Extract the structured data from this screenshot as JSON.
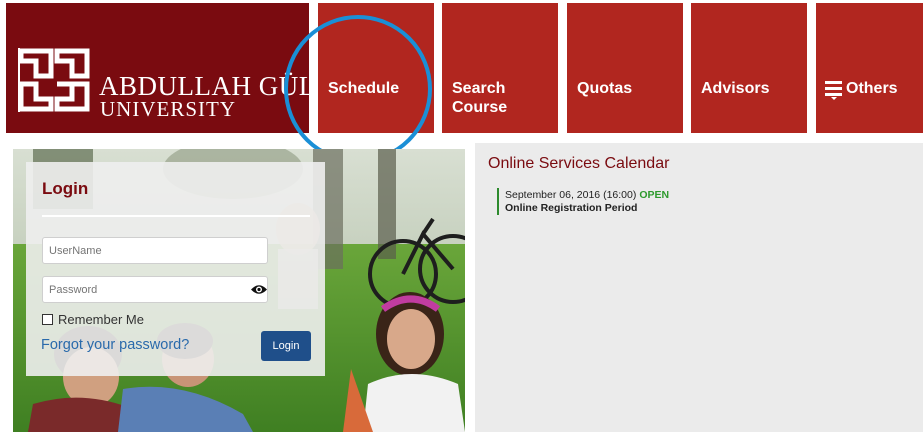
{
  "logo": {
    "line1": "ABDULLAH GÜL",
    "line2": "UNIVERSITY"
  },
  "nav": {
    "items": [
      {
        "label": "Schedule"
      },
      {
        "label": "Search\nCourse"
      },
      {
        "label": "Quotas"
      },
      {
        "label": "Advisors"
      },
      {
        "label": "Others",
        "icon": "hamburger-menu-icon"
      }
    ]
  },
  "login": {
    "title": "Login",
    "username_placeholder": "UserName",
    "password_placeholder": "Password",
    "remember_label": "Remember Me",
    "forgot_label": "Forgot your password?",
    "button_label": "Login"
  },
  "calendar": {
    "title": "Online Services Calendar",
    "entries": [
      {
        "date": "September 06, 2016 (16:00)",
        "status": "OPEN",
        "description": "Online Registration Period"
      }
    ]
  },
  "colors": {
    "brand_dark": "#7a0b10",
    "nav_tile": "#b1261f",
    "highlight_ring": "#1a8fd6",
    "status_open": "#2d9a2d"
  }
}
